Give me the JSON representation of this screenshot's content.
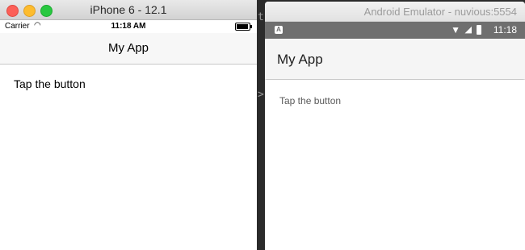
{
  "ios": {
    "window_title": "iPhone 6 - 12.1",
    "carrier": "Carrier",
    "time": "11:18 AM",
    "nav_title": "My App",
    "label": "Tap the button"
  },
  "separator": {
    "glyph_top": "t",
    "glyph_bottom": ">"
  },
  "android": {
    "window_title": "Android Emulator - nuvious:5554",
    "app_icon_letter": "A",
    "time": "11:18",
    "toolbar_title": "My App",
    "label": "Tap the button"
  }
}
